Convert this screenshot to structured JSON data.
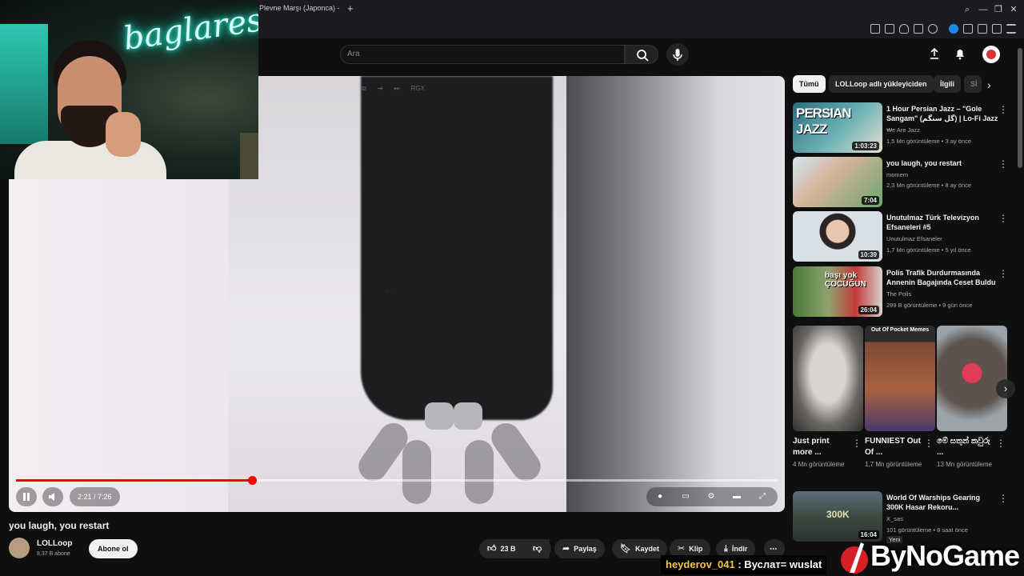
{
  "browser": {
    "tab_title": "Plevne Marşı (Japonca) -",
    "new_tab": "+"
  },
  "search": {
    "placeholder": "Ara"
  },
  "webcam": {
    "neon_sign": "baglares"
  },
  "player": {
    "tool_label": "RGX",
    "time": "2:21 / 7:26",
    "progress_fraction": 0.31,
    "accent_color": "#ff0000"
  },
  "video": {
    "title": "you laugh, you restart",
    "channel": "LOLLoop",
    "subscribers": "8,37 B abone",
    "subscribe_label": "Abone ol",
    "actions": {
      "likes": "23 B",
      "share": "Paylaş",
      "save": "Kaydet",
      "clip": "Klip",
      "download": "İndir"
    }
  },
  "sidebar": {
    "chips": [
      "Tümü",
      "LOLLoop adlı yükleyiciden",
      "İlgili",
      "Sİ"
    ],
    "recommendations": [
      {
        "title": "1 Hour Persian Jazz – \"Gole Sangam\" (گل سنگم) | Lo-Fi Jazz ...",
        "channel": "We Are Jazz",
        "meta": "1,5 Mn görüntüleme • 3 ay önce",
        "duration": "1:03:23",
        "thumb_text": "PERSIAN JAZZ"
      },
      {
        "title": "you laugh, you restart",
        "channel": "momem",
        "meta": "2,3 Mn görüntüleme • 8 ay önce",
        "duration": "7:04"
      },
      {
        "title": "Unutulmaz Türk Televizyon Efsaneleri #5",
        "channel": "Unutulmaz Efsaneler",
        "meta": "1,7 Mn görüntüleme • 5 yıl önce",
        "duration": "10:39"
      },
      {
        "title": "Polis Trafik Durdurmasında Annenin Bagajında Ceset Buldu",
        "channel": "The Polis",
        "meta": "299 B görüntüleme • 9 gün önce",
        "duration": "26:04",
        "thumb_text": "başı yok ÇOCUĞUN"
      },
      {
        "title": "World Of Warships Gearing 300K Hasar Rekoru...",
        "channel": "X_sas",
        "meta": "101 görüntüleme • 8 saat önce",
        "duration": "16:04",
        "badge": "Yeni",
        "thumb_text": "300K"
      }
    ],
    "shorts": [
      {
        "title": "Just print more ...",
        "views": "4 Mn görüntüleme"
      },
      {
        "title": "FUNNIEST Out Of ...",
        "views": "1,7 Mn görüntüleme",
        "thumb_text": "Out Of Pocket Memes"
      },
      {
        "title": "මේ සතුන් කවුරු ...",
        "views": "13 Mn görüntüleme"
      }
    ]
  },
  "overlay": {
    "chat_user": "heyderov_041",
    "chat_message": ": Вуслат= wuslat",
    "logo": "ByNoGame"
  }
}
